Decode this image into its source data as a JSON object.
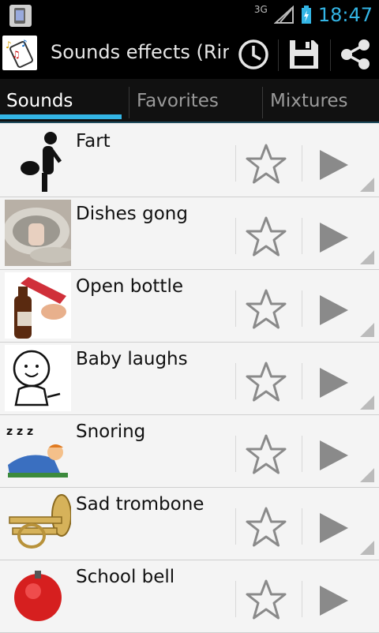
{
  "status_bar": {
    "network": "3G",
    "time": "18:47"
  },
  "app": {
    "title": "Sounds effects (Ring"
  },
  "toolbar": {
    "history_icon": "clock-icon",
    "save_icon": "save-icon",
    "share_icon": "share-icon"
  },
  "tabs": [
    {
      "label": "Sounds",
      "active": true
    },
    {
      "label": "Favorites",
      "active": false
    },
    {
      "label": "Mixtures",
      "active": false
    }
  ],
  "sounds": [
    {
      "name": "Fart",
      "thumb": "person-fart-icon"
    },
    {
      "name": "Dishes gong",
      "thumb": "gong-icon"
    },
    {
      "name": "Open bottle",
      "thumb": "bottle-opener-icon"
    },
    {
      "name": "Baby laughs",
      "thumb": "baby-icon"
    },
    {
      "name": "Snoring",
      "thumb": "sleeping-person-icon"
    },
    {
      "name": "Sad trombone",
      "thumb": "trombone-icon"
    },
    {
      "name": "School bell",
      "thumb": "bell-icon"
    }
  ],
  "colors": {
    "accent": "#33b5e5",
    "icon_gray": "#8a8a8a"
  }
}
